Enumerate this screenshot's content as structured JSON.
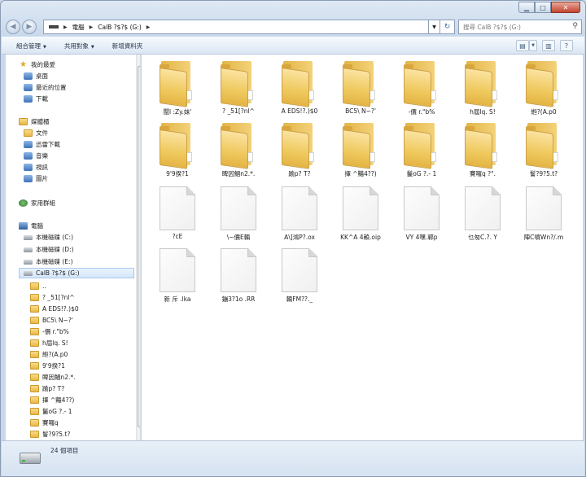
{
  "window": {
    "controls": {
      "minimize": "▁",
      "maximize": "□",
      "close": "✕"
    }
  },
  "address": {
    "crumbs": [
      "電腦",
      "CalB  ?$?$ (G:)"
    ],
    "search_placeholder": "搜尋 CalB  ?$?$ (G:)"
  },
  "toolbar": {
    "organize": "組合管理",
    "share": "共用對象",
    "new_folder": "新增資料夾"
  },
  "nav": {
    "favorites": "我的最愛",
    "desktop": "桌面",
    "recent": "最近的位置",
    "downloads": "下載",
    "libraries": "媒體櫃",
    "documents": "文件",
    "thunder": "迅雷下載",
    "music": "音樂",
    "videos": "視訊",
    "pictures": "圖片",
    "homegroup": "家用群組",
    "computer": "電腦",
    "disk_c": "本機磁碟 (C:)",
    "disk_d": "本機磁碟 (D:)",
    "disk_e": "本機磁碟 (E:)",
    "drive_g": "CalB  ?$?$ (G:)",
    "subfolders": [
      "..",
      "? _51[?nl^",
      "A  EDS!?.)$0",
      "BC5\\  N~?'",
      "-價    r.\"b%",
      "h屆lq.  S!",
      "縆?(A.p0",
      "9'9揆?1",
      "睥因鯧n2.*.",
      "踰p?  T?",
      "擇  ^豔4??)",
      "鬣oG    ?.- 1",
      "賽囉q",
      "鬙?9?5.t?"
    ]
  },
  "items": [
    {
      "type": "folder",
      "label": "闡l  :Zy.妹'"
    },
    {
      "type": "folder",
      "label": "? _51[?nl^"
    },
    {
      "type": "folder",
      "label": "A  EDS!?.)$0"
    },
    {
      "type": "folder",
      "label": "BC5\\  N~?'"
    },
    {
      "type": "folder",
      "label": "-價    r.\"b%"
    },
    {
      "type": "folder",
      "label": "h屆lq.  S!"
    },
    {
      "type": "folder",
      "label": "縆?(A.p0"
    },
    {
      "type": "folder",
      "label": "9'9揆?1"
    },
    {
      "type": "folder",
      "label": "睥因鯧n2.*."
    },
    {
      "type": "folder",
      "label": "踰p?  T?"
    },
    {
      "type": "folder",
      "label": "擇  ^豔4??)"
    },
    {
      "type": "folder",
      "label": "鬣oG    ?.- 1"
    },
    {
      "type": "folder",
      "label": "賽囉q    ?\"."
    },
    {
      "type": "folder",
      "label": "鬙?9?5.t?"
    },
    {
      "type": "file",
      "label": "?cE"
    },
    {
      "type": "file",
      "label": "\\~價E輛"
    },
    {
      "type": "file",
      "label": "A\\]鴻P?.ox"
    },
    {
      "type": "file",
      "label": "KK^A  4賴.oip"
    },
    {
      "type": "file",
      "label": "VY  4嘿.鄲p"
    },
    {
      "type": "file",
      "label": "乜匆C.?.    Y"
    },
    {
      "type": "file",
      "label": "陣C噴Wn?/.m"
    },
    {
      "type": "file",
      "label": "新    斥    .lka"
    },
    {
      "type": "file",
      "label": "鏰3?1o  .RR"
    },
    {
      "type": "file",
      "label": "輛FM??._"
    }
  ],
  "status": {
    "count": "24 個項目"
  }
}
